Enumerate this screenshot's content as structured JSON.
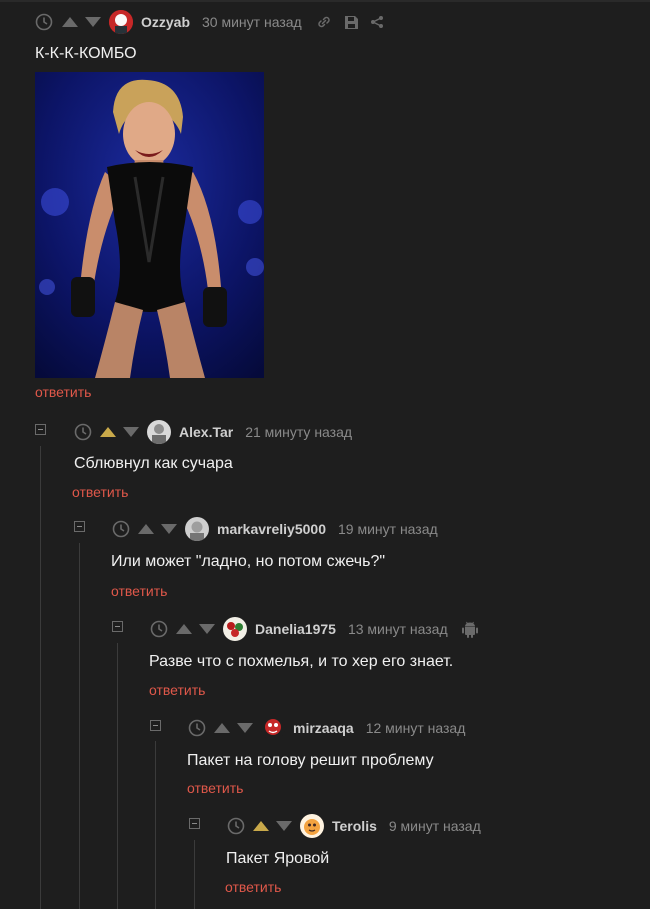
{
  "comments": [
    {
      "author": "Ozzyab",
      "time": "30 минут назад",
      "text": "К-К-К-КОМБО",
      "reply": "ответить",
      "image_alt": "изображение"
    },
    {
      "author": "Alex.Tar",
      "time": "21 минуту назад",
      "text": "Сблювнул как сучара",
      "reply": "ответить"
    },
    {
      "author": "markavreliy5000",
      "time": "19 минут назад",
      "text": "Или может \"ладно, но потом сжечь?\"",
      "reply": "ответить"
    },
    {
      "author": "Danelia1975",
      "time": "13 минут назад",
      "text": "Разве что с похмелья, и то хер его знает.",
      "reply": "ответить"
    },
    {
      "author": "mirzaaqa",
      "time": "12 минут назад",
      "text": "Пакет на голову решит проблему",
      "reply": "ответить"
    },
    {
      "author": "Terolis",
      "time": "9 минут назад",
      "text": "Пакет Яровой",
      "reply": "ответить"
    }
  ],
  "colors": {
    "background": "#1e1e1e",
    "reply_link": "#e0584a",
    "upvote_active": "#c9a94a"
  }
}
